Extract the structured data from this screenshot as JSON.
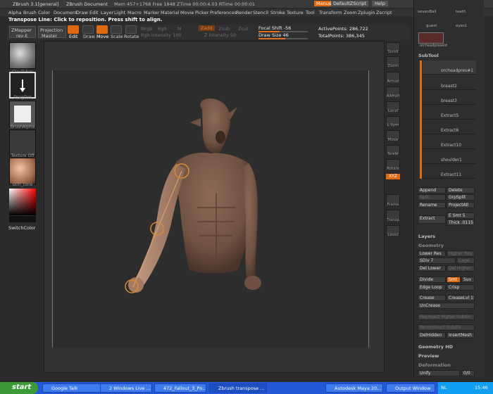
{
  "titlebar": {
    "app": "ZBrush 3.1[general]",
    "document": "ZBrush Document",
    "mem": "Mem 457+1768 Free 1848 ZTime 00:00:4.03 RTime 00:00:01",
    "menus_btn": "Menus",
    "script_btn": "DefaultZScript",
    "help_btn": "Help"
  },
  "menubar": {
    "items": [
      "Alpha",
      "Brush",
      "Color",
      "Document",
      "Draw",
      "Edit",
      "Layer",
      "Light",
      "Macro",
      "Marker",
      "Material",
      "Movie",
      "Picker",
      "Preferences",
      "Render",
      "Stencil",
      "Stroke",
      "Texture",
      "Tool",
      "Transform",
      "Zoom",
      "Zplugin",
      "Zscript"
    ]
  },
  "hint": "Transpose Line: Click to reposition. Press shift to align.",
  "toolbar": {
    "zmapper": "ZMapper",
    "zmapper_sub": "rev-E",
    "projection": "Projection",
    "projection_sub": "Master",
    "edit": "Edit",
    "draw": "Draw",
    "move": "Move",
    "scale": "Scale",
    "rotate": "Rotate",
    "mrgb": "Mrgb",
    "rgb": "Rgb",
    "m": "M",
    "zadd": "Zadd",
    "zsub": "Zsub",
    "zcut": "Zcut",
    "rgb_intensity": "Rgb Intensity 100",
    "z_intensity": "Z Intensity 50",
    "focal_shift": "Focal Shift -56",
    "draw_size": "Draw Size 46",
    "active_points": "ActivePoints: 286,722",
    "total_points": "TotalPoints: 386,345"
  },
  "left_shelf": {
    "items": [
      "ClayTubes",
      "DragDot",
      "BrushAlpha",
      "Texture Off",
      "skin_tone"
    ],
    "switch_color": "SwitchColor"
  },
  "right_shelf": {
    "items": [
      "Scroll",
      "Zoom",
      "Actual",
      "AAHalf",
      "Local",
      "L.Sym",
      "Move",
      "Scale",
      "Rotate",
      "Frame",
      "Transp",
      "Lasso"
    ],
    "xyz": "XYZ"
  },
  "palette": {
    "top_thumbs": [
      "sevenBall",
      "teeth",
      "guest",
      "eyes1",
      "orcheadpresent"
    ],
    "subtool_header": "SubTool",
    "subtools": [
      "orcheadpres#1",
      "breast2",
      "breast3",
      "Extract5",
      "Extract6",
      "Extract10",
      "shoulder1",
      "Extract11"
    ],
    "append": "Append",
    "delete": "Delete",
    "split": "Split",
    "grpsplit": "GrpSplit",
    "rename": "Rename",
    "projectall": "ProjectAll",
    "extract": "Extract",
    "e_smt": "E Smt 5",
    "thick": "Thick .0115",
    "layers": "Layers",
    "geometry": "Geometry",
    "lower_res": "Lower Res",
    "higher_res": "Higher Res",
    "sdiv": "SDiv 7",
    "cage": "Cage",
    "del_lower": "Del Lower",
    "del_higher": "Del Higher",
    "divide": "Divide",
    "smt": "Smt",
    "suv": "Suv",
    "edge_loop": "Edge Loop",
    "crisp": "Crisp",
    "crease": "Crease",
    "creaselvl": "CreaseLvl 15",
    "uncrease": "UnCrease",
    "reproject": "Reproject Higher Subdiv",
    "reconstruct": "Reconstruct Subdiv",
    "delhidden": "DelHidden",
    "insertmesh": "InsertMesh",
    "geometry_hd": "Geometry HD",
    "preview": "Preview",
    "deformation": "Deformation",
    "unify": "Unify",
    "unify_val": "0/0"
  },
  "taskbar": {
    "start": "start",
    "tasks": [
      "Google Talk",
      "2 Windows Live ...",
      "472_Fallout_3_Po...",
      "Zbrush transpose ...",
      "Autodesk Maya 20...",
      "Output Window"
    ],
    "lang": "NL",
    "clock": "15:46"
  },
  "colors": {
    "accent": "#e06a10",
    "skin": "#7a5a48",
    "taskbar": "#2458d8"
  }
}
